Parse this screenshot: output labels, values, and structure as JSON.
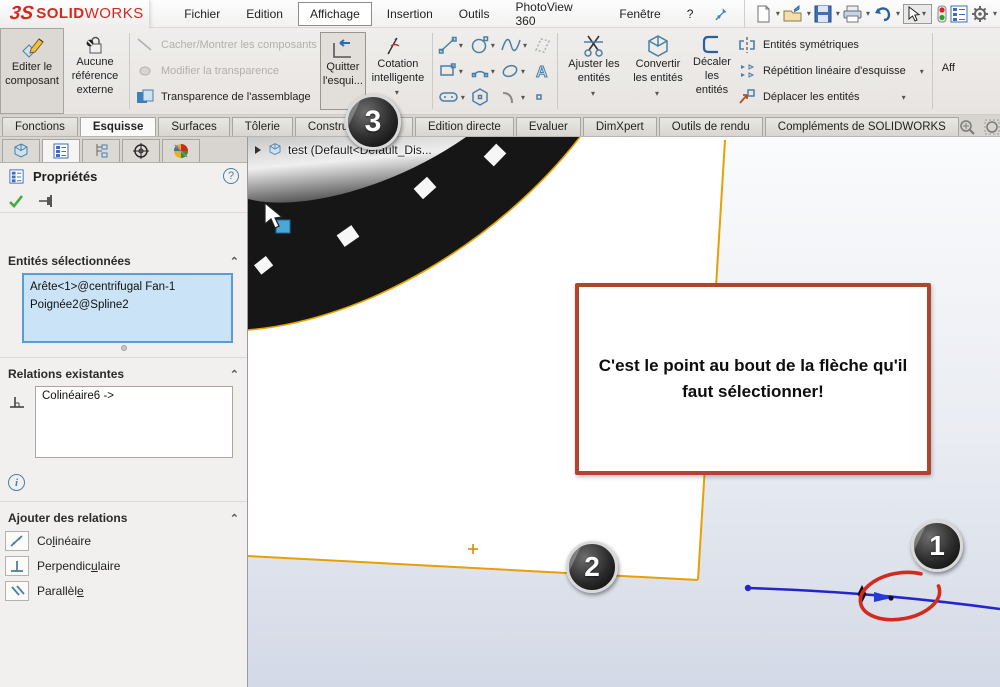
{
  "app": {
    "brand_prefix": "3S",
    "brand_solid": "SOLID",
    "brand_works": "WORKS"
  },
  "menubar": {
    "items": [
      "Fichier",
      "Edition",
      "Affichage",
      "Insertion",
      "Outils",
      "PhotoView 360",
      "Fenêtre",
      "?"
    ],
    "active_item": "Affichage",
    "pin_icon": "pushpin-icon"
  },
  "quick_toolbar": {
    "icons": [
      "new-document",
      "open-file",
      "save",
      "print",
      "undo",
      "select-cursor",
      "rebuild-traffic-light",
      "options-list",
      "settings-gear"
    ]
  },
  "ribbon": {
    "edit_component": "Editer le composant",
    "no_external_ref": "Aucune référence externe",
    "hide_show": "Cacher/Montrer les composants",
    "change_transparency": "Modifier la transparence",
    "assembly_transparency": "Transparence de l'assemblage",
    "exit_sketch_l1": "Quitter",
    "exit_sketch_l2": "l'esqui...",
    "smart_dimension_l1": "Cotation",
    "smart_dimension_l2": "intelligente",
    "trim_entities_l1": "Ajuster les",
    "trim_entities_l2": "entités",
    "convert_entities_l1": "Convertir",
    "convert_entities_l2": "les entités",
    "offset_entities_l1": "Décaler",
    "offset_entities_l2": "les",
    "offset_entities_l3": "entités",
    "mirror_entities": "Entités symétriques",
    "linear_pattern": "Répétition linéaire d'esquisse",
    "move_entities": "Déplacer les entités",
    "truncated_right": "Aff",
    "sketch_tool_icons": [
      "line",
      "circle",
      "spline",
      "plane",
      "rectangle",
      "arc",
      "ellipse",
      "text",
      "slot",
      "polygon",
      "fillet",
      "point"
    ]
  },
  "command_tabs": {
    "items": [
      "Fonctions",
      "Esquisse",
      "Surfaces",
      "Tôlerie",
      "Constructions sou",
      "Edition directe",
      "Evaluer",
      "DimXpert",
      "Outils de rendu",
      "Compléments de SOLIDWORKS"
    ],
    "active": "Esquisse",
    "headsup_icons": [
      "zoom-fit",
      "zoom-area",
      "previous-view",
      "section-view"
    ]
  },
  "property_panel": {
    "tab_icons": [
      "feature-tree",
      "property-manager",
      "configuration",
      "dimxpert-target",
      "display-appearance"
    ],
    "active_tab": "property-manager",
    "title": "Propriétés",
    "help": "?",
    "actions": [
      "ok-check",
      "keep-visible-pin"
    ],
    "selected_entities": {
      "header": "Entités sélectionnées",
      "items": [
        "Arête<1>@centrifugal Fan-1",
        "Poignée2@Spline2"
      ]
    },
    "existing_relations": {
      "header": "Relations existantes",
      "items": [
        "Colinéaire6 ->"
      ]
    },
    "info_icon": "i",
    "add_relations": {
      "header": "Ajouter des relations",
      "items": [
        {
          "pre": "Co",
          "accel": "l",
          "post": "inéaire"
        },
        {
          "pre": "Perpendic",
          "accel": "u",
          "post": "laire"
        },
        {
          "pre": "Parallèl",
          "accel": "e",
          "post": ""
        }
      ]
    }
  },
  "viewport": {
    "breadcrumb": "test  (Default<Default_Dis...",
    "annotation_text": "C'est le point au bout de la flèche qu'il faut sélectionner!",
    "badges": [
      "1",
      "2",
      "3"
    ],
    "colors": {
      "sketch_orange": "#e8a000",
      "spline_blue": "#2525cd",
      "highlight_red": "#d32a20",
      "annotation_border": "#af4431",
      "selection_fill": "#cbe3f6"
    }
  }
}
